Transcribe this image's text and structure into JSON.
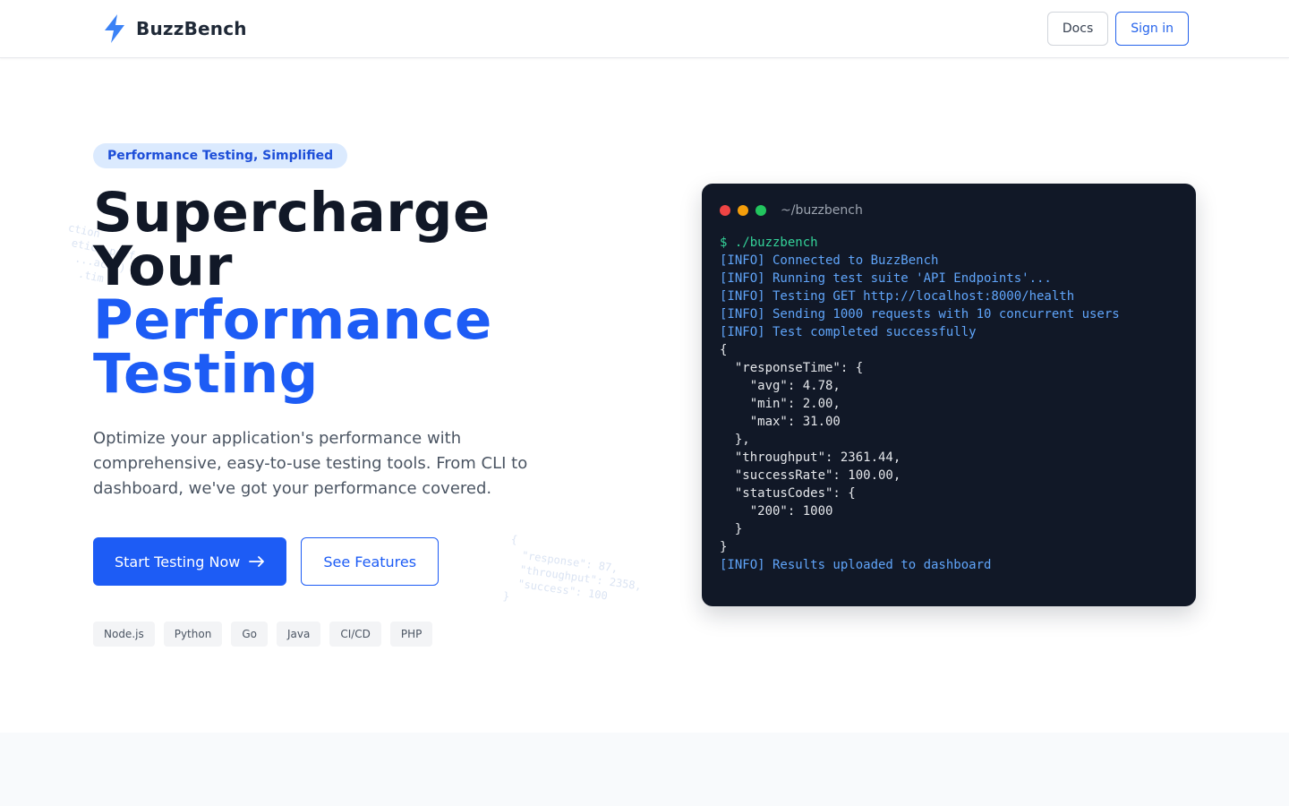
{
  "header": {
    "brand": "BuzzBench",
    "nav": {
      "docs": "Docs",
      "signin": "Sign in"
    }
  },
  "hero": {
    "badge": "Performance Testing, Simplified",
    "headline_dark": [
      "Supercharge",
      "Your"
    ],
    "headline_blue": [
      "Performance",
      "Testing"
    ],
    "subtext": "Optimize your application's performance with comprehensive, easy-to-use testing tools. From CLI to dashboard, we've got your performance covered.",
    "cta_primary": "Start Testing Now",
    "cta_secondary": "See Features",
    "tags": [
      "Node.js",
      "Python",
      "Go",
      "Java",
      "CI/CD",
      "PHP"
    ]
  },
  "deco": {
    "left": "ction\n etics.perf\n  ...ack()\n   .tim",
    "right": "{\n  \"response\": 87,\n  \"throughput\": 2358,\n  \"success\": 100\n}"
  },
  "terminal": {
    "title": "~/buzzbench",
    "lines": [
      {
        "type": "prompt",
        "text": "$ ./buzzbench"
      },
      {
        "type": "info",
        "text": "[INFO] Connected to BuzzBench"
      },
      {
        "type": "info",
        "text": "[INFO] Running test suite 'API Endpoints'..."
      },
      {
        "type": "info",
        "text": "[INFO] Testing GET http://localhost:8000/health"
      },
      {
        "type": "info",
        "text": "[INFO] Sending 1000 requests with 10 concurrent users"
      },
      {
        "type": "info",
        "text": "[INFO] Test completed successfully"
      },
      {
        "type": "json",
        "text": "{"
      },
      {
        "type": "json",
        "text": "  \"responseTime\": {"
      },
      {
        "type": "json",
        "text": "    \"avg\": 4.78,"
      },
      {
        "type": "json",
        "text": "    \"min\": 2.00,"
      },
      {
        "type": "json",
        "text": "    \"max\": 31.00"
      },
      {
        "type": "json",
        "text": "  },"
      },
      {
        "type": "json",
        "text": "  \"throughput\": 2361.44,"
      },
      {
        "type": "json",
        "text": "  \"successRate\": 100.00,"
      },
      {
        "type": "json",
        "text": "  \"statusCodes\": {"
      },
      {
        "type": "json",
        "text": "    \"200\": 1000"
      },
      {
        "type": "json",
        "text": "  }"
      },
      {
        "type": "json",
        "text": "}"
      },
      {
        "type": "info",
        "text": "[INFO] Results uploaded to dashboard"
      }
    ]
  },
  "icons": {
    "brand": "lightning-bolt-icon",
    "cta_arrow": "arrow-right-icon"
  },
  "colors": {
    "accent": "#1d5cf5",
    "terminal_bg": "#111827",
    "dot_red": "#ef4444",
    "dot_yellow": "#f59e0b",
    "dot_green": "#22c55e"
  }
}
